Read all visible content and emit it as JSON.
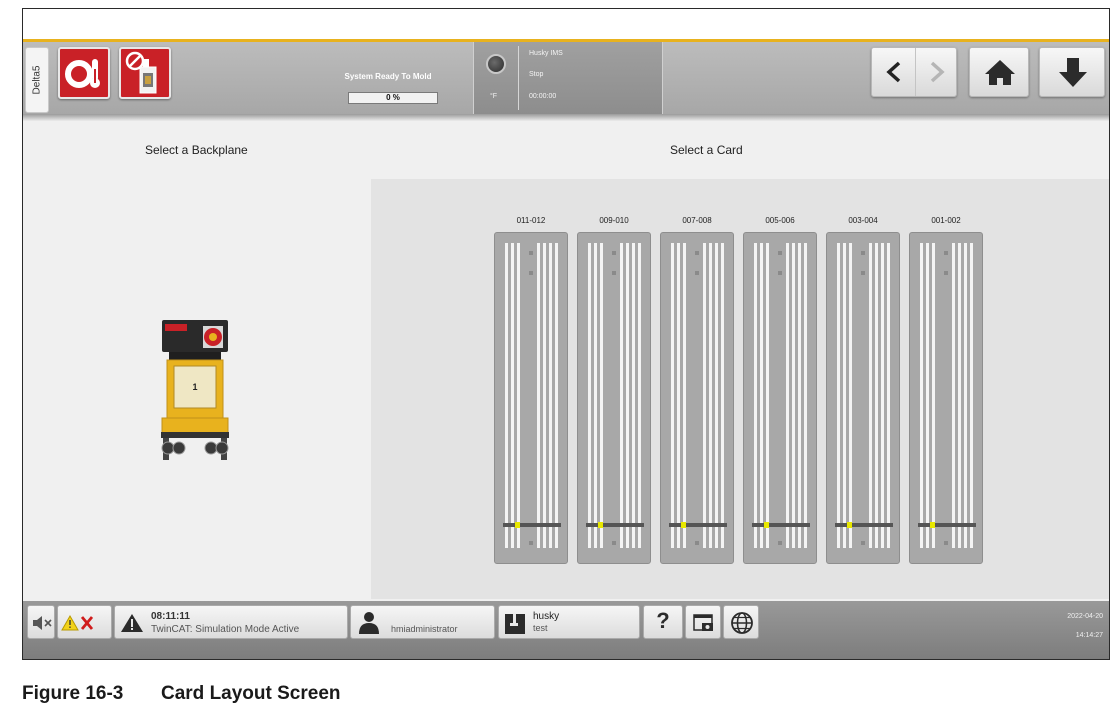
{
  "header": {
    "vertical_tab": "Delta5",
    "status_title": "System Ready To Mold",
    "progress_percent": 0,
    "progress_label": "0 %",
    "ims": {
      "name": "Husky IMS",
      "state": "Stop",
      "timer": "00:00:00",
      "unit": "°F"
    }
  },
  "main": {
    "backplane_heading": "Select a Backplane",
    "card_heading": "Select a Card",
    "backplane_label": "1",
    "cards": [
      {
        "label": "011-012",
        "indicator_color": "#e8e800"
      },
      {
        "label": "009-010",
        "indicator_color": "#e8e800"
      },
      {
        "label": "007-008",
        "indicator_color": "#e8e800"
      },
      {
        "label": "005-006",
        "indicator_color": "#e8e800"
      },
      {
        "label": "003-004",
        "indicator_color": "#e8e800"
      },
      {
        "label": "001-002",
        "indicator_color": "#e8e800"
      }
    ]
  },
  "footer": {
    "alarm_time": "08:11:11",
    "alarm_message": "TwinCAT: Simulation Mode Active",
    "user": "hmiadministrator",
    "mold_name": "husky",
    "mold_sub": "test",
    "help_label": "?",
    "date": "2022-04-20",
    "time": "14:14:27"
  },
  "caption": {
    "number": "Figure 16-3",
    "title": "Card Layout Screen"
  },
  "colors": {
    "accent_yellow": "#e8b21e",
    "alarm_red": "#c92127",
    "header_gray": "#b0b0b0"
  },
  "icons": [
    "heater-alarm-icon",
    "mold-disabled-icon",
    "temperature-knob-icon",
    "chevron-left-icon",
    "chevron-right-icon",
    "home-icon",
    "download-arrow-icon",
    "mute-icon",
    "warning-clear-icon",
    "warning-icon",
    "user-icon",
    "husky-logo-icon",
    "help-icon",
    "screenshot-icon",
    "globe-icon"
  ]
}
